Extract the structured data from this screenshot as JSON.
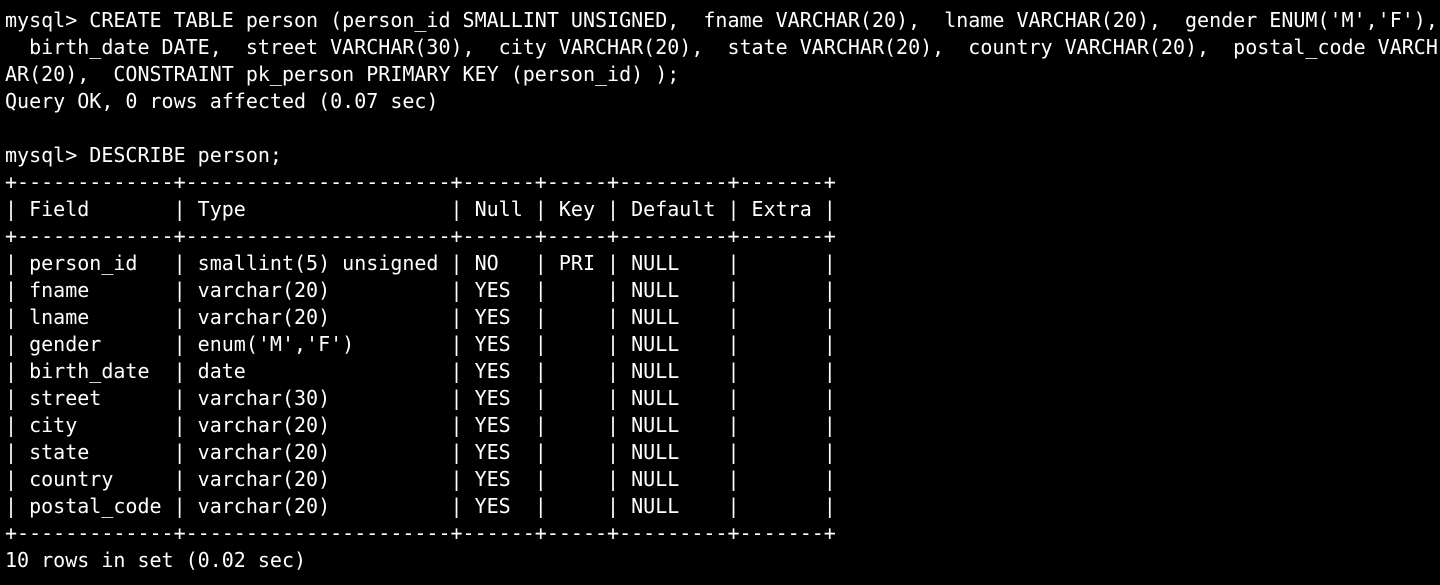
{
  "terminal": {
    "create_cmd": [
      "mysql> CREATE TABLE person (person_id SMALLINT UNSIGNED,  fname VARCHAR(20),  lname VARCHAR(20),  gender ENUM('M','F'),",
      "  birth_date DATE,  street VARCHAR(30),  city VARCHAR(20),  state VARCHAR(20),  country VARCHAR(20),  postal_code VARCH",
      "AR(20),  CONSTRAINT pk_person PRIMARY KEY (person_id) );"
    ],
    "create_result": "Query OK, 0 rows affected (0.07 sec)",
    "describe_cmd": "mysql> DESCRIBE person;",
    "table": {
      "border": "+-------------+----------------------+------+-----+---------+-------+",
      "header": "| Field       | Type                 | Null | Key | Default | Extra |",
      "rows": [
        "| person_id   | smallint(5) unsigned | NO   | PRI | NULL    |       |",
        "| fname       | varchar(20)          | YES  |     | NULL    |       |",
        "| lname       | varchar(20)          | YES  |     | NULL    |       |",
        "| gender      | enum('M','F')        | YES  |     | NULL    |       |",
        "| birth_date  | date                 | YES  |     | NULL    |       |",
        "| street      | varchar(30)          | YES  |     | NULL    |       |",
        "| city        | varchar(20)          | YES  |     | NULL    |       |",
        "| state       | varchar(20)          | YES  |     | NULL    |       |",
        "| country     | varchar(20)          | YES  |     | NULL    |       |",
        "| postal_code | varchar(20)          | YES  |     | NULL    |       |"
      ]
    },
    "describe_result": "10 rows in set (0.02 sec)"
  },
  "colors": {
    "background": "#000000",
    "foreground": "#ffffff"
  }
}
